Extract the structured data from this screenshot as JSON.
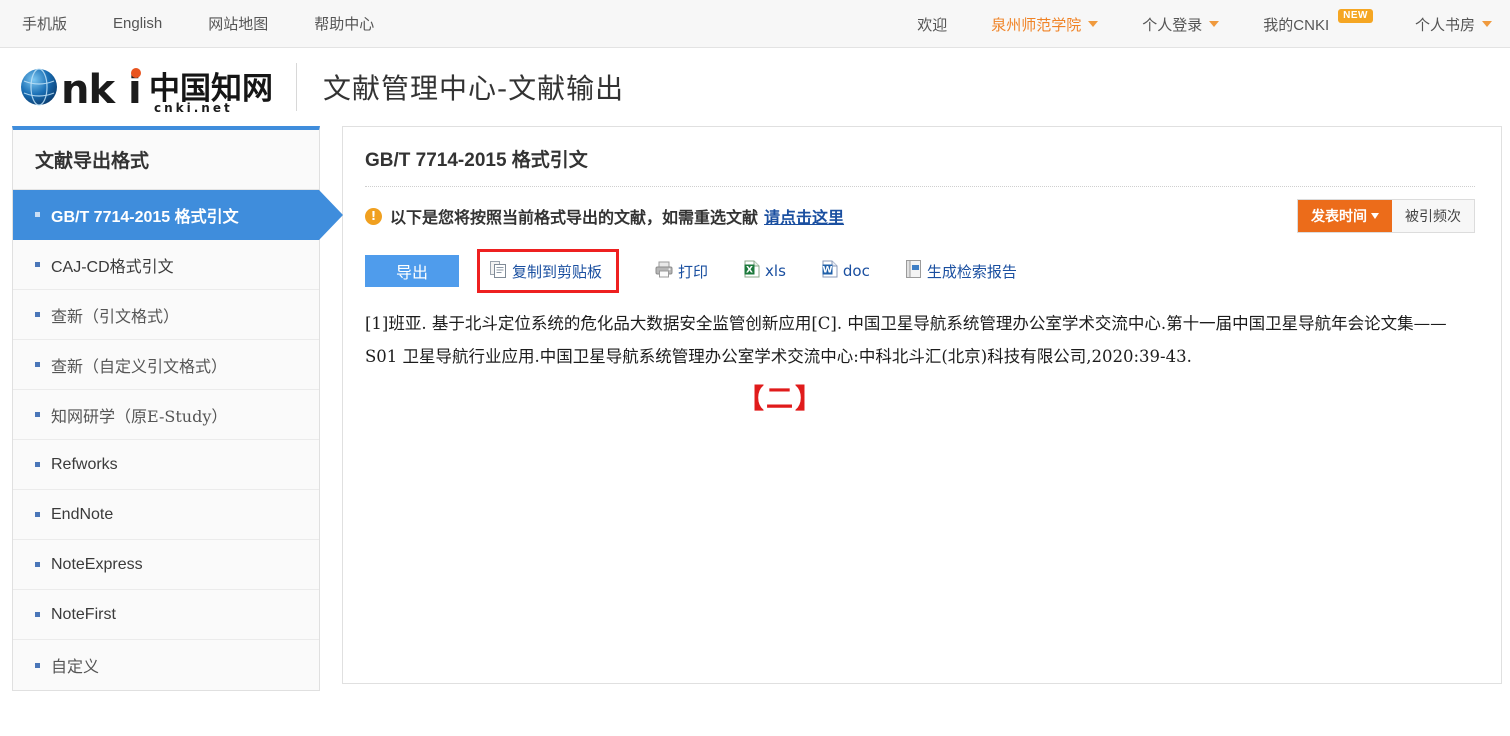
{
  "topbar": {
    "left_links": [
      {
        "label": "手机版",
        "name": "mobile-version-link"
      },
      {
        "label": "English",
        "name": "english-link"
      },
      {
        "label": "网站地图",
        "name": "sitemap-link"
      },
      {
        "label": "帮助中心",
        "name": "help-center-link"
      }
    ],
    "welcome": "欢迎",
    "institution": "泉州师范学院",
    "personal_login": "个人登录",
    "my_cnki": "我的CNKI",
    "new_badge": "NEW",
    "personal_library": "个人书房"
  },
  "header": {
    "logo_text": "中国知网",
    "logo_sub": "cnki.net",
    "title": "文献管理中心-文献输出"
  },
  "sidebar": {
    "title": "文献导出格式",
    "items": [
      {
        "label": "GB/T 7714-2015 格式引文",
        "name": "sidebar-item-gbt7714",
        "active": true,
        "cn": false
      },
      {
        "label": "CAJ-CD格式引文",
        "name": "sidebar-item-cajcd",
        "active": false,
        "cn": false
      },
      {
        "label": "查新（引文格式）",
        "name": "sidebar-item-novelty-citation",
        "active": false,
        "cn": true
      },
      {
        "label": "查新（自定义引文格式）",
        "name": "sidebar-item-novelty-custom",
        "active": false,
        "cn": true
      },
      {
        "label": "知网研学（原E-Study）",
        "name": "sidebar-item-estudy",
        "active": false,
        "cn": true
      },
      {
        "label": "Refworks",
        "name": "sidebar-item-refworks",
        "active": false,
        "cn": false
      },
      {
        "label": "EndNote",
        "name": "sidebar-item-endnote",
        "active": false,
        "cn": false
      },
      {
        "label": "NoteExpress",
        "name": "sidebar-item-noteexpress",
        "active": false,
        "cn": false
      },
      {
        "label": "NoteFirst",
        "name": "sidebar-item-notefirst",
        "active": false,
        "cn": false
      },
      {
        "label": "自定义",
        "name": "sidebar-item-custom",
        "active": false,
        "cn": true
      }
    ]
  },
  "content": {
    "title": "GB/T 7714-2015 格式引文",
    "warn_glyph": "!",
    "notice_text": "以下是您将按照当前格式导出的文献，如需重选文献",
    "notice_link": "请点击这里",
    "sort": {
      "primary": "发表时间",
      "secondary": "被引频次"
    },
    "toolbar": {
      "export_label": "导出",
      "copy_label": "复制到剪贴板",
      "print_label": "打印",
      "xls_label": "xls",
      "doc_label": "doc",
      "report_label": "生成检索报告"
    },
    "citation_text": "[1]班亚. 基于北斗定位系统的危化品大数据安全监管创新应用[C]. 中国卫星导航系统管理办公室学术交流中心.第十一届中国卫星导航年会论文集——S01 卫星导航行业应用.中国卫星导航系统管理办公室学术交流中心:中科北斗汇(北京)科技有限公司,2020:39-43.",
    "annotation_mark": "【二】"
  },
  "colors": {
    "accent_blue": "#3f8ddc",
    "link_blue": "#1a4fa0",
    "orange": "#ec6c1a",
    "highlight_red": "#ee2020",
    "annotation_red": "#e01b1b"
  }
}
